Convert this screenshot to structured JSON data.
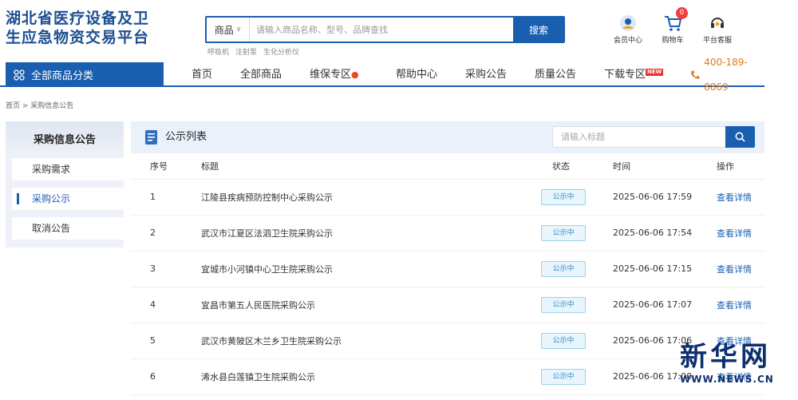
{
  "header": {
    "logo_line1": "湖北省医疗设备及卫",
    "logo_line2": "生应急物资交易平台",
    "search": {
      "category": "商品",
      "placeholder": "请输入商品名称、型号、品牌查找",
      "button": "搜索"
    },
    "hot_keywords": [
      "呼吸机",
      "注射泵",
      "生化分析仪"
    ],
    "icons": [
      {
        "label": "会员中心",
        "icon": "member-icon"
      },
      {
        "label": "购物车",
        "icon": "cart-icon",
        "badge": "0"
      },
      {
        "label": "平台客服",
        "icon": "service-icon"
      }
    ]
  },
  "nav": {
    "all_categories": "全部商品分类",
    "items": [
      "首页",
      "全部商品",
      "维保专区",
      "帮助中心",
      "采购公告",
      "质量公告",
      "下载专区"
    ],
    "new_tag": "NEW",
    "phone": "400-189-8869"
  },
  "breadcrumb": "首页 > 采购信息公告",
  "sidebar": {
    "title": "采购信息公告",
    "items": [
      "采购需求",
      "采购公示",
      "取消公告"
    ],
    "active_index": 1
  },
  "panel": {
    "title": "公示列表",
    "search_placeholder": "请输入标题",
    "columns": [
      "序号",
      "标题",
      "状态",
      "时间",
      "操作"
    ],
    "rows": [
      {
        "no": "1",
        "title": "江陵县疾病预防控制中心采购公示",
        "status": "公示中",
        "time": "2025-06-06 17:59",
        "action": "查看详情"
      },
      {
        "no": "2",
        "title": "武汉市江夏区法泗卫生院采购公示",
        "status": "公示中",
        "time": "2025-06-06 17:54",
        "action": "查看详情"
      },
      {
        "no": "3",
        "title": "宜城市小河镇中心卫生院采购公示",
        "status": "公示中",
        "time": "2025-06-06 17:15",
        "action": "查看详情"
      },
      {
        "no": "4",
        "title": "宜昌市第五人民医院采购公示",
        "status": "公示中",
        "time": "2025-06-06 17:07",
        "action": "查看详情"
      },
      {
        "no": "5",
        "title": "武汉市黄陂区木兰乡卫生院采购公示",
        "status": "公示中",
        "time": "2025-06-06 17:06",
        "action": "查看详情"
      },
      {
        "no": "6",
        "title": "浠水县白莲镇卫生院采购公示",
        "status": "公示中",
        "time": "2025-06-06 17:00",
        "action": "查看详情"
      }
    ]
  },
  "watermark": {
    "text": "新华网",
    "url": "WWW.NEWS.CN"
  },
  "colors": {
    "primary": "#1a5eb0",
    "phone": "#e07a1f",
    "status_bg": "#e8f5fc",
    "badge": "#f23d3d"
  }
}
